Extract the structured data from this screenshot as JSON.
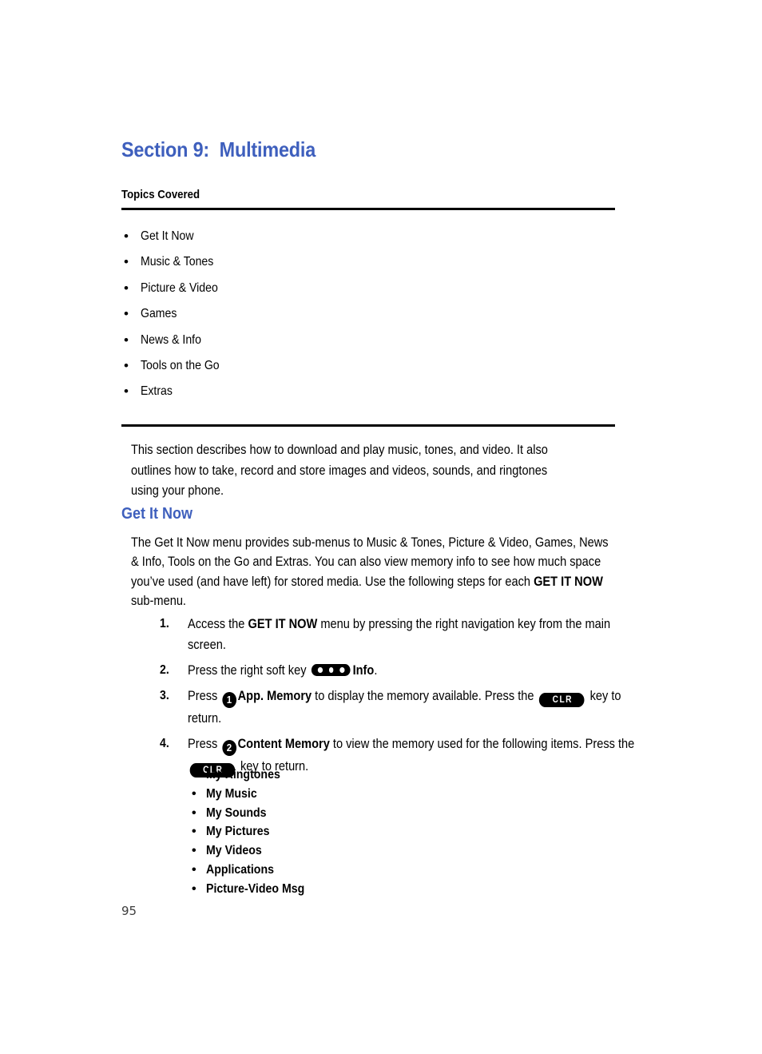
{
  "document": {
    "section_title": "Section 9:  Multimedia",
    "topics_label": "Topics Covered",
    "page_number": "95",
    "accent_color": "#3e5fbd",
    "rule_color": "#000000"
  },
  "topics": [
    {
      "label": "Get It Now"
    },
    {
      "label": "Music & Tones"
    },
    {
      "label": "Picture & Video"
    },
    {
      "label": "Games"
    },
    {
      "label": "News & Info"
    },
    {
      "label": "Tools on the Go"
    },
    {
      "label": "Extras"
    }
  ],
  "intro": {
    "text": "This section describes how to download and play music, tones, and video. It also outlines how to take, record and store images and videos, sounds, and ringtones using your phone."
  },
  "get_it_now": {
    "heading": "Get It Now",
    "paragraph_part1": "The Get It Now menu provides sub-menus to Music & Tones, Picture & Video, Games, News & Info, Tools on the Go and Extras. You can also view memory info to see how much space you’ve used (and have left) for stored media. Use the following steps for each ",
    "paragraph_bold": "GET IT NOW",
    "paragraph_part2": " sub-menu."
  },
  "steps": {
    "step1": {
      "number": "1.",
      "text_part1": "Access the ",
      "bold1": "GET IT NOW",
      "text_part2": " menu by pressing the right navigation key from the main screen."
    },
    "step2": {
      "number": "2.",
      "text_part1": "Press the right soft key ",
      "icon": "soft-key-three-dots",
      "bold1": "Info",
      "text_part2": "."
    },
    "step3": {
      "number": "3.",
      "text_part1": "Press ",
      "key_digit": "1",
      "bold1": "App. Memory",
      "text_part2": " to display the memory available. Press the ",
      "key_label": "CLR",
      "text_part3": " key to return."
    },
    "step4": {
      "number": "4.",
      "text_part1": "Press ",
      "key_digit": "2",
      "bold1": "Content Memory",
      "text_part2": " to view the memory used for the following items. Press the ",
      "key_label": "CLR",
      "text_part3": " key to return."
    }
  },
  "content_memory_items": [
    {
      "label": "My Ringtones"
    },
    {
      "label": "My Music"
    },
    {
      "label": "My Sounds"
    },
    {
      "label": "My Pictures"
    },
    {
      "label": "My Videos"
    },
    {
      "label": "Applications"
    },
    {
      "label": "Picture-Video Msg"
    }
  ]
}
